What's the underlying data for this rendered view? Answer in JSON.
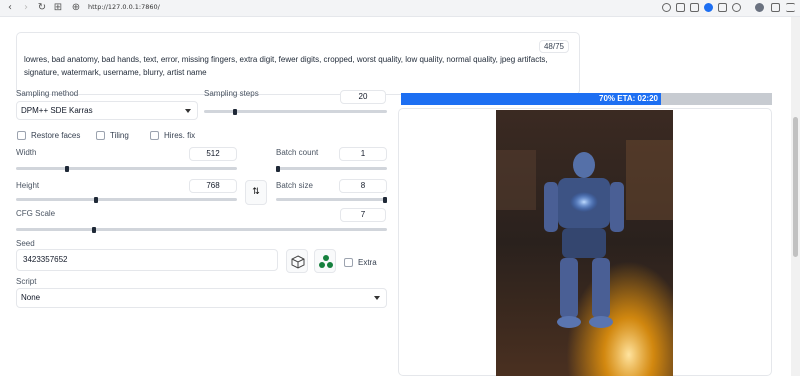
{
  "browser": {
    "url": "http://127.0.0.1:7860/",
    "back_glyph": "‹",
    "forward_glyph": "›",
    "reload_glyph": "↻",
    "apps_glyph": "⊞",
    "site_glyph": "⊕"
  },
  "prompt": {
    "text": "lowres, bad anatomy, bad hands, text, error, missing fingers, extra digit, fewer digits, cropped, worst quality, low quality, normal quality, jpeg artifacts, signature, watermark, username, blurry, artist name",
    "token_count": "48/75"
  },
  "sampling_method": {
    "label": "Sampling method",
    "value": "DPM++ SDE Karras"
  },
  "sampling_steps": {
    "label": "Sampling steps",
    "value": "20",
    "fraction": 0.17
  },
  "checkboxes": {
    "restore_faces": "Restore faces",
    "tiling": "Tiling",
    "hires_fix": "Hires. fix"
  },
  "width": {
    "label": "Width",
    "value": "512",
    "fraction": 0.23
  },
  "height": {
    "label": "Height",
    "value": "768",
    "fraction": 0.36
  },
  "batch_count": {
    "label": "Batch count",
    "value": "1",
    "fraction": 0.0
  },
  "batch_size": {
    "label": "Batch size",
    "value": "8",
    "fraction": 1.0
  },
  "cfg_scale": {
    "label": "CFG Scale",
    "value": "7",
    "fraction": 0.21
  },
  "swap_glyph": "⇅",
  "seed": {
    "label": "Seed",
    "value": "3423357652",
    "extra_label": "Extra"
  },
  "script": {
    "label": "Script",
    "value": "None"
  },
  "progress": {
    "text": "70% ETA: 02:20",
    "fraction": 0.7
  },
  "colors": {
    "progress": "#1d6ff2",
    "accent": "#f97316"
  },
  "icons": [
    "search-icon",
    "share-icon",
    "camera-icon",
    "shield-icon",
    "send-icon",
    "heart-icon",
    "extension-icon",
    "profile-icon",
    "download-icon",
    "menu-icon",
    "dice-icon",
    "recycle-icon"
  ]
}
